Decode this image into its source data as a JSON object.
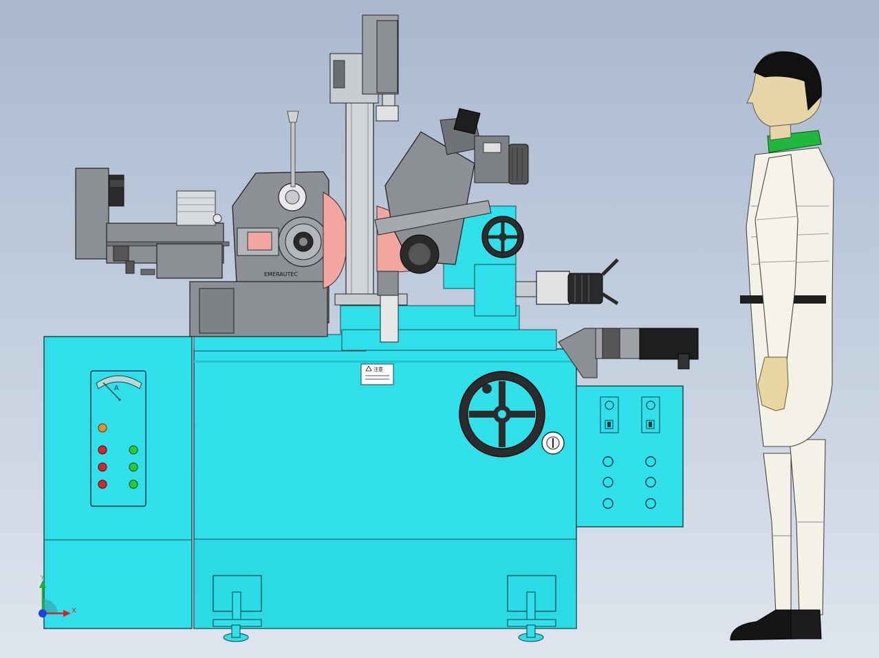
{
  "viewport": {
    "background_top": "#a9b8cf",
    "background_bottom": "#dfe5ee"
  },
  "machine": {
    "body_color": "#2fe0ea",
    "grey_parts_color": "#8c8f94",
    "wheel_color": "#f3a6a0",
    "brand_label": "EMERAUTEC",
    "warning_label": {
      "title": "注意",
      "icon": "warning-triangle-icon"
    },
    "ammeter": {
      "unit": "A"
    },
    "left_panel": {
      "indicator_orange": "#e8902a",
      "indicators_red": [
        "#e0202a",
        "#e0202a",
        "#e0202a"
      ],
      "indicators_green": [
        "#28c83a",
        "#28c83a",
        "#28c83a"
      ]
    },
    "right_panel": {
      "switch_count": 2,
      "button_rows": 3,
      "button_cols": 2
    }
  },
  "human_model": {
    "suit_color": "#f4f2e6",
    "collar_color": "#1eb83c",
    "hair_color": "#111111",
    "shoe_color": "#151515"
  },
  "axis_triad": {
    "x_label": "X",
    "y_label": "Y",
    "x_color": "#e02020",
    "y_color": "#20b020",
    "z_color": "#2040e0"
  }
}
